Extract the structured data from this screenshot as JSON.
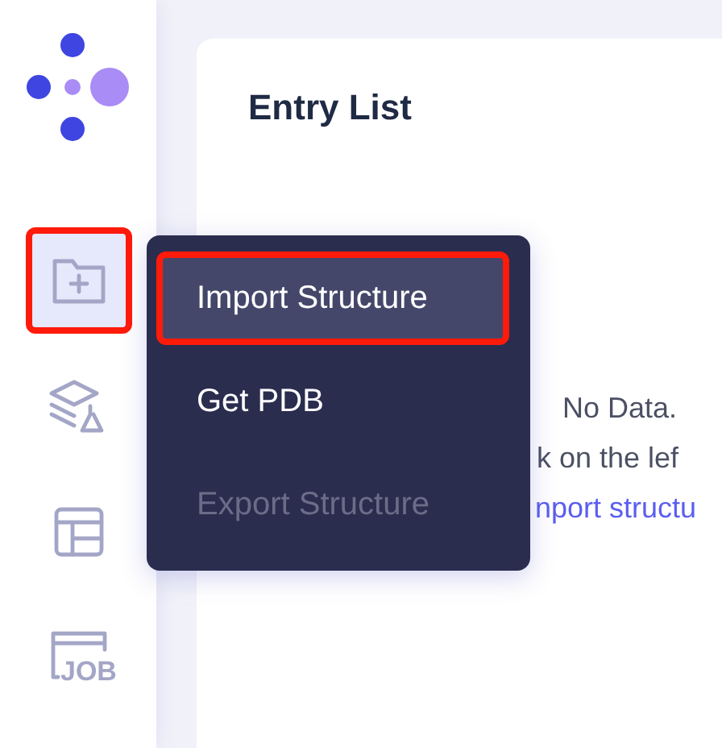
{
  "sidebar": {
    "items": [
      {
        "kind": "folder-plus",
        "selected": true,
        "highlighted": true
      },
      {
        "kind": "layers-flask",
        "selected": false,
        "highlighted": false
      },
      {
        "kind": "layout",
        "selected": false,
        "highlighted": false
      },
      {
        "kind": "job",
        "label": "JOB",
        "selected": false,
        "highlighted": false
      }
    ]
  },
  "panel": {
    "title": "Entry List",
    "empty_state": {
      "message": "No Data.",
      "lines": [
        {
          "kind": "text",
          "text": "k on the lef"
        },
        {
          "kind": "link",
          "text": "nport structu"
        }
      ]
    }
  },
  "menu": {
    "items": [
      {
        "label": "Import Structure",
        "hovered": true,
        "highlighted": true,
        "disabled": false
      },
      {
        "label": "Get PDB",
        "hovered": false,
        "highlighted": false,
        "disabled": false
      },
      {
        "label": "Export Structure",
        "hovered": false,
        "highlighted": false,
        "disabled": true
      }
    ]
  }
}
